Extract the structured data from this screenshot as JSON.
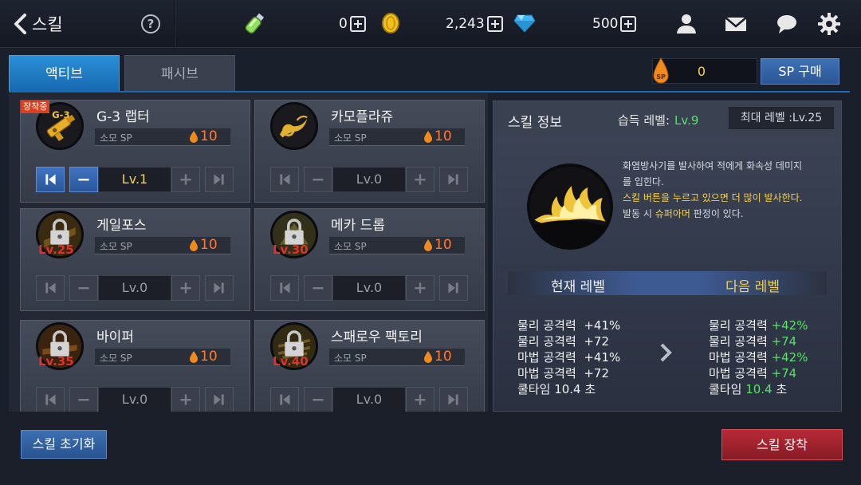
{
  "header": {
    "back_title": "스킬",
    "help_icon": "?",
    "currencies": [
      {
        "name": "potion",
        "value": "0"
      },
      {
        "name": "gold",
        "value": "2,243"
      },
      {
        "name": "gem",
        "value": "500"
      }
    ]
  },
  "tabs": {
    "active": "액티브",
    "passive": "패시브"
  },
  "sp": {
    "value": "0",
    "drop_label": "SP",
    "buy_label": "SP 구매"
  },
  "skill_card_labels": {
    "cost_label": "소모 SP"
  },
  "skills": [
    {
      "name": "G-3 랩터",
      "cost": "10",
      "level": "Lv.1",
      "equipped": "장착중",
      "lock_level": "",
      "icon": "raptor-icon"
    },
    {
      "name": "카모플라쥬",
      "cost": "10",
      "level": "Lv.0",
      "equipped": "",
      "lock_level": "",
      "icon": "camouflage-icon"
    },
    {
      "name": "게일포스",
      "cost": "10",
      "level": "Lv.0",
      "equipped": "",
      "lock_level": "Lv.25",
      "icon": "lock-icon"
    },
    {
      "name": "메카 드롭",
      "cost": "10",
      "level": "Lv.0",
      "equipped": "",
      "lock_level": "Lv.30",
      "icon": "lock-icon"
    },
    {
      "name": "바이퍼",
      "cost": "10",
      "level": "Lv.0",
      "equipped": "",
      "lock_level": "Lv.35",
      "icon": "lock-icon"
    },
    {
      "name": "스패로우 팩토리",
      "cost": "10",
      "level": "Lv.0",
      "equipped": "",
      "lock_level": "Lv.40",
      "icon": "lock-icon"
    }
  ],
  "info": {
    "title": "스킬 정보",
    "acquire_label": "습득 레벨:",
    "acquire_value": "Lv.9",
    "max_level": "최대 레벨 :Lv.25",
    "desc_line1": "화염방사기를 발사하여 적에게 화속성 데미지",
    "desc_line2": "를 입힌다.",
    "desc_line3": "스킬 버튼을 누르고 있으면 더 많이 발사한다.",
    "desc_line4_a": "발동 시 ",
    "desc_line4_b": "슈퍼아머",
    "desc_line4_c": " 판정이 있다.",
    "current_label": "현재 레벨",
    "next_label": "다음 레벨",
    "current_stats": [
      {
        "label": "물리 공격력",
        "value": "+41%"
      },
      {
        "label": "물리 공격력",
        "value": "+72"
      },
      {
        "label": "마법 공격력",
        "value": "+41%"
      },
      {
        "label": "마법 공격력",
        "value": "+72"
      },
      {
        "label": "쿨타임",
        "value": "10.4 초"
      }
    ],
    "next_stats": [
      {
        "label": "물리 공격력",
        "value": "+42%"
      },
      {
        "label": "물리 공격력",
        "value": "+74"
      },
      {
        "label": "마법 공격력",
        "value": "+42%"
      },
      {
        "label": "마법 공격력",
        "value": "+74"
      },
      {
        "label": "쿨타임",
        "value": "10.4",
        "suffix": "초"
      }
    ]
  },
  "footer": {
    "reset_label": "스킬 초기화",
    "equip_label": "스킬 장착"
  },
  "colors": {
    "accent_blue": "#1f7cc9",
    "sp_yellow": "#f5d24b",
    "cost_orange": "#ff7a2e",
    "stat_green": "#5ae06a",
    "lock_red": "#e0312a",
    "equip_red": "#a8232f"
  }
}
